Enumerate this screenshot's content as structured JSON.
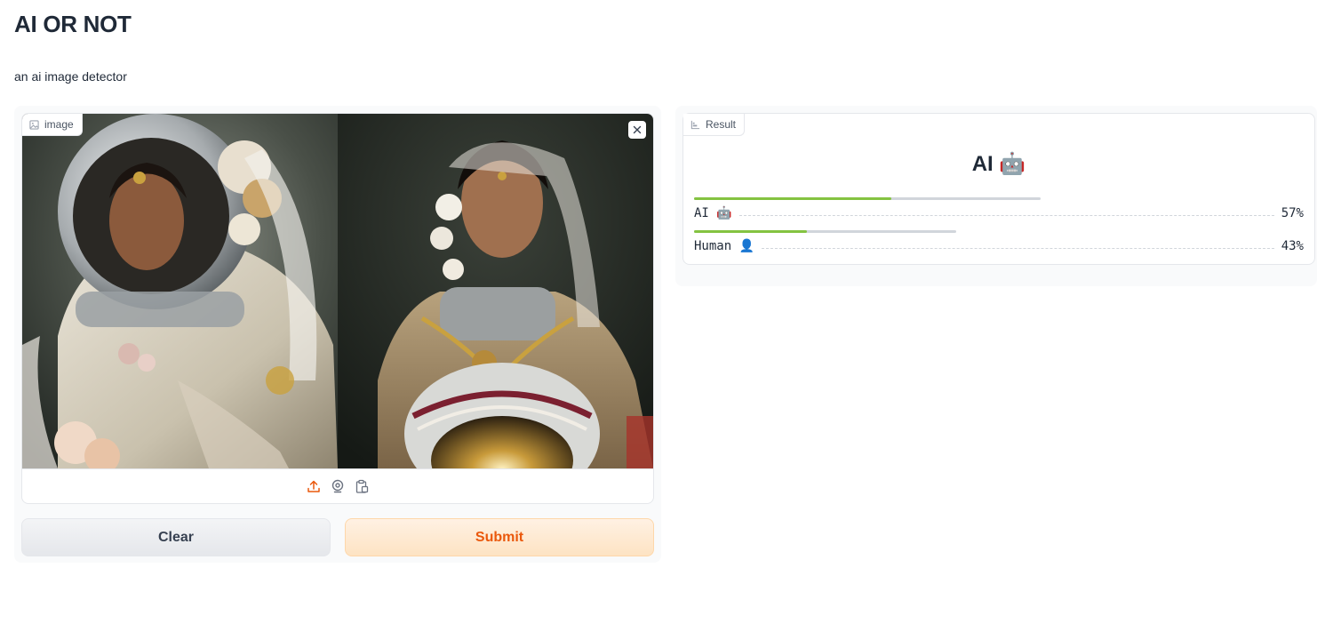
{
  "header": {
    "title": "AI OR NOT",
    "description": "an ai image detector"
  },
  "input": {
    "label": "image",
    "image_description": "two portraits of women in ornate bridal astronaut suits",
    "source_icons": [
      "upload-icon",
      "webcam-icon",
      "clipboard-icon"
    ]
  },
  "buttons": {
    "clear": "Clear",
    "submit": "Submit"
  },
  "output": {
    "label": "Result",
    "top_label": "AI 🤖",
    "confidences": [
      {
        "label": "AI 🤖",
        "percent": "57%",
        "value": 0.57
      },
      {
        "label": "Human 👤",
        "percent": "43%",
        "value": 0.43
      }
    ]
  },
  "colors": {
    "accent": "#ea580c",
    "bar_fill": "#84c341",
    "bar_track": "#d1d5db"
  }
}
